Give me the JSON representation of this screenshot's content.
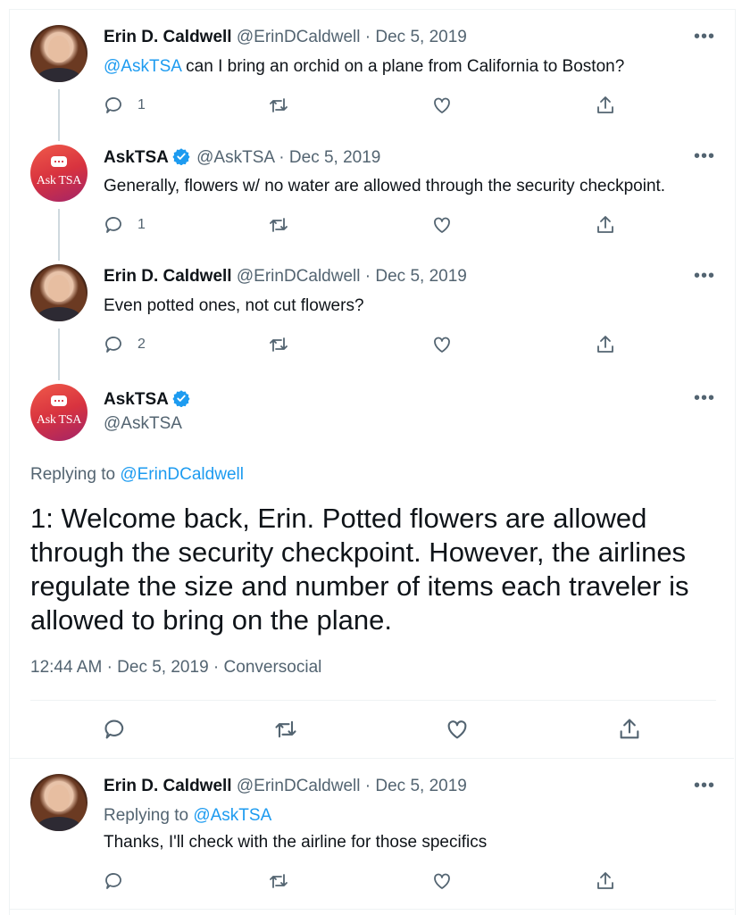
{
  "tweets": [
    {
      "name": "Erin D. Caldwell",
      "handle": "@ErinDCaldwell",
      "date": "Dec 5, 2019",
      "mention": "@AskTSA",
      "text": " can I bring an orchid on a plane from California to Boston?",
      "reply_count": "1"
    },
    {
      "name": "AskTSA",
      "handle": "@AskTSA",
      "date": "Dec 5, 2019",
      "text": "Generally, flowers w/ no water are allowed through the security checkpoint.",
      "reply_count": "1"
    },
    {
      "name": "Erin D. Caldwell",
      "handle": "@ErinDCaldwell",
      "date": "Dec 5, 2019",
      "text": "Even potted ones, not cut flowers?",
      "reply_count": "2"
    }
  ],
  "main_tweet": {
    "name": "AskTSA",
    "handle": "@AskTSA",
    "replying_label": "Replying to ",
    "replying_to": "@ErinDCaldwell",
    "text": "1: Welcome back, Erin. Potted flowers are allowed through the security checkpoint. However, the airlines regulate the size and number of items each traveler is allowed to bring on the plane.",
    "time": "12:44 AM",
    "date": "Dec 5, 2019",
    "source": "Conversocial"
  },
  "reply": {
    "name": "Erin D. Caldwell",
    "handle": "@ErinDCaldwell",
    "date": "Dec 5, 2019",
    "replying_label": "Replying to ",
    "replying_to": "@AskTSA",
    "text": "Thanks, I'll check with the airline for those specifics"
  },
  "ui": {
    "separator": "·",
    "more": "•••",
    "tsa_avatar_text": "Ask TSA"
  },
  "colors": {
    "accent": "#1d9bf0",
    "secondary_text": "#536471",
    "divider": "#eff3f4"
  },
  "icons": [
    "reply-icon",
    "retweet-icon",
    "like-icon",
    "share-icon",
    "verified-badge-icon",
    "more-icon"
  ]
}
